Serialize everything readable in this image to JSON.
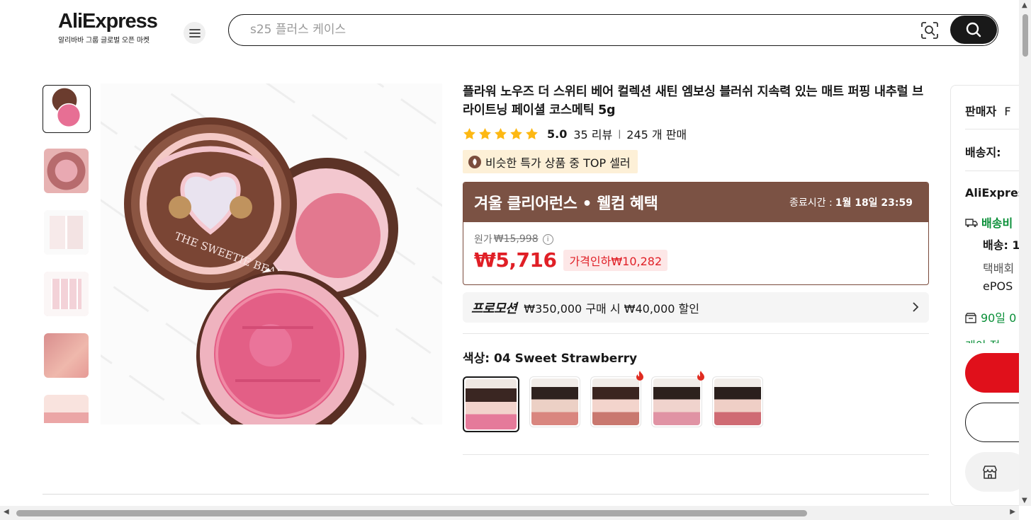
{
  "header": {
    "logo_text": "AliExpress",
    "logo_tagline": "알리바바 그룹 글로벌 오픈 마켓",
    "search_placeholder": "s25 플러스 케이스"
  },
  "product": {
    "title": "플라워 노우즈 더 스위티 베어 컬렉션 새틴 엠보싱 블러쉬 지속력 있는 매트 퍼핑 내추럴 브라이트닝 페이셜 코스메틱 5g",
    "rating": "5.0",
    "reviews": "35 리뷰",
    "sold": "245 개 판매",
    "badge": "비슷한 특가 상품 중 TOP 셀러",
    "sale_banner": {
      "title": "겨울 클리어런스 • 웰컴 혜택",
      "end_label": "종료시간 :",
      "end_time": "1월 18일 23:59"
    },
    "original_label": "원가",
    "original_price": "₩15,998",
    "current_price": "₩5,716",
    "price_cut": "가격인하₩10,282",
    "promotion_label": "프로모션",
    "promotion_text": "₩350,000 구매 시 ₩40,000 할인",
    "color_label": "색상:",
    "color_value": "04 Sweet Strawberry"
  },
  "side_panel": {
    "seller_label": "판매자",
    "seller_value": "F",
    "ship_to_label": "배송지:",
    "shipper": "AliExpres",
    "shipping_fee": "배송비",
    "delivery": "배송: 1",
    "courier": "택배회",
    "courier2": "ePOS",
    "return": "90일 0",
    "more": "게이 적"
  },
  "colors": {
    "accent": "#e01f26",
    "banner": "#7b5244",
    "badge_bg": "#fdf0d7"
  }
}
